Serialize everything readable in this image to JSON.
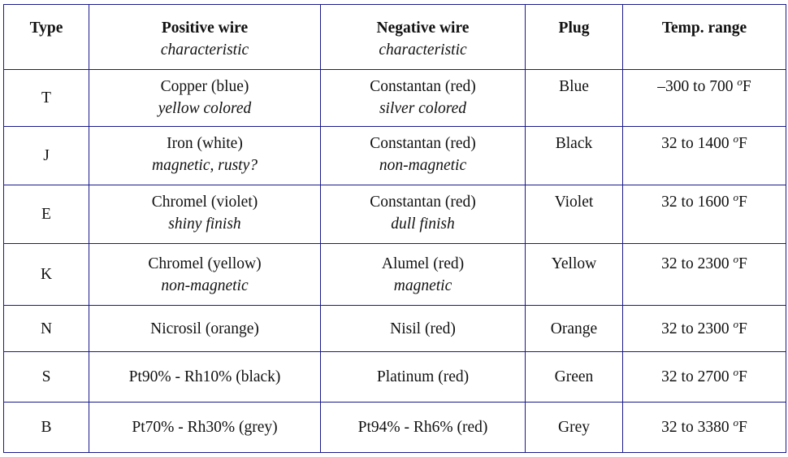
{
  "table": {
    "headers": [
      {
        "main": "Type",
        "sub": ""
      },
      {
        "main": "Positive wire",
        "sub": "characteristic"
      },
      {
        "main": "Negative wire",
        "sub": "characteristic"
      },
      {
        "main": "Plug",
        "sub": ""
      },
      {
        "main": "Temp. range",
        "sub": ""
      }
    ],
    "temp_unit": "F",
    "temp_degree_symbol": "o",
    "rows": [
      {
        "type": "T",
        "positive": "Copper (blue)",
        "positive_note": "yellow colored",
        "negative": "Constantan (red)",
        "negative_note": "silver colored",
        "plug": "Blue",
        "temp": "–300 to 700"
      },
      {
        "type": "J",
        "positive": "Iron (white)",
        "positive_note": "magnetic, rusty?",
        "negative": "Constantan (red)",
        "negative_note": "non-magnetic",
        "plug": "Black",
        "temp": "32 to 1400"
      },
      {
        "type": "E",
        "positive": "Chromel (violet)",
        "positive_note": "shiny finish",
        "negative": "Constantan (red)",
        "negative_note": "dull finish",
        "plug": "Violet",
        "temp": "32 to 1600"
      },
      {
        "type": "K",
        "positive": "Chromel (yellow)",
        "positive_note": "non-magnetic",
        "negative": "Alumel (red)",
        "negative_note": "magnetic",
        "plug": "Yellow",
        "temp": "32 to 2300"
      },
      {
        "type": "N",
        "positive": "Nicrosil (orange)",
        "positive_note": "",
        "negative": "Nisil (red)",
        "negative_note": "",
        "plug": "Orange",
        "temp": "32 to 2300"
      },
      {
        "type": "S",
        "positive": "Pt90% - Rh10% (black)",
        "positive_note": "",
        "negative": "Platinum (red)",
        "negative_note": "",
        "plug": "Green",
        "temp": "32 to 2700"
      },
      {
        "type": "B",
        "positive": "Pt70% - Rh30% (grey)",
        "positive_note": "",
        "negative": "Pt94% - Rh6% (red)",
        "negative_note": "",
        "plug": "Grey",
        "temp": "32 to 3380"
      }
    ]
  },
  "colors": {
    "grid": "#1a1a8c",
    "text": "#111111"
  }
}
